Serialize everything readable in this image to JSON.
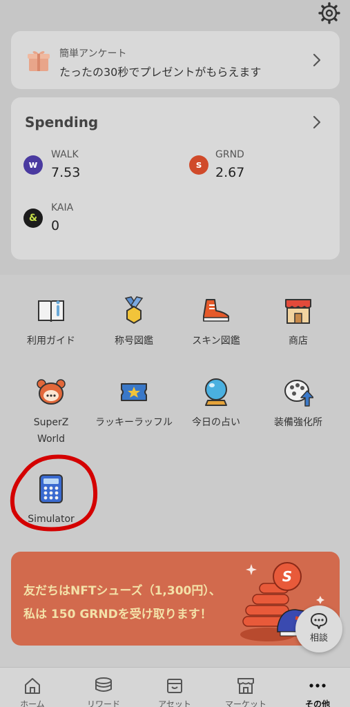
{
  "survey": {
    "title": "簡単アンケート",
    "subtitle": "たったの30秒でプレゼントがもらえます"
  },
  "spending": {
    "title": "Spending",
    "coins": [
      {
        "name": "WALK",
        "value": "7.53",
        "color": "#4a3aa0"
      },
      {
        "name": "GRND",
        "value": "2.67",
        "color": "#d04a2a"
      },
      {
        "name": "KAIA",
        "value": "0",
        "color": "#1c1c1c"
      }
    ]
  },
  "menu": {
    "items": [
      {
        "label": "利用ガイド",
        "icon": "guide-book-icon"
      },
      {
        "label": "称号図鑑",
        "icon": "medal-icon"
      },
      {
        "label": "スキン図鑑",
        "icon": "sneaker-icon"
      },
      {
        "label": "商店",
        "icon": "shop-icon"
      },
      {
        "label": "SuperZ World",
        "icon": "superz-mascot-icon"
      },
      {
        "label": "ラッキーラッフル",
        "icon": "raffle-ticket-icon"
      },
      {
        "label": "今日の占い",
        "icon": "crystal-ball-icon"
      },
      {
        "label": "装備強化所",
        "icon": "upgrade-icon"
      },
      {
        "label": "Simulator",
        "icon": "calculator-icon"
      }
    ]
  },
  "banner": {
    "line1": "友だちはNFTシューズ（1,300円）、",
    "line2": "私は 150 GRNDを受け取ります！"
  },
  "consult": {
    "label": "相談"
  },
  "tabbar": {
    "tabs": [
      {
        "label": "ホーム",
        "icon": "home-icon"
      },
      {
        "label": "リワード",
        "icon": "coins-icon"
      },
      {
        "label": "アセット",
        "icon": "box-icon"
      },
      {
        "label": "マーケット",
        "icon": "market-icon"
      },
      {
        "label": "その他",
        "icon": "more-icon",
        "active": true
      }
    ]
  },
  "colors": {
    "accent_orange": "#d26a4d",
    "banner_text": "#f3e1a8",
    "highlight_red": "#d40000"
  }
}
